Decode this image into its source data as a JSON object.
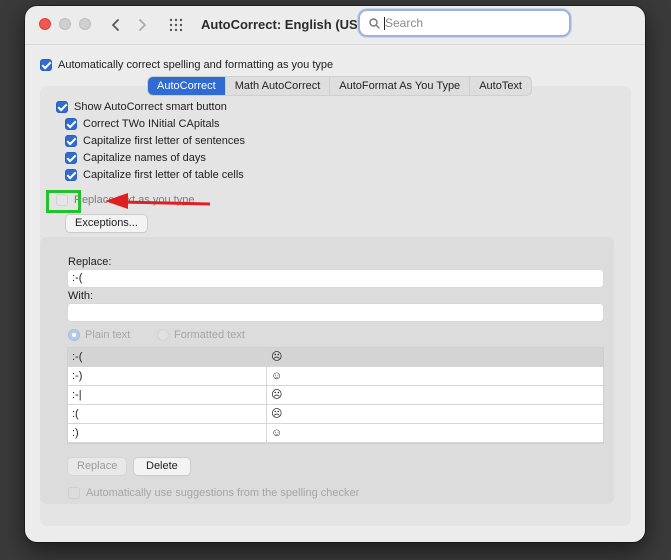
{
  "window": {
    "title": "AutoCorrect: English (US)",
    "search_placeholder": "Search"
  },
  "top_option": {
    "label": "Automatically correct spelling and formatting as you type",
    "checked": true
  },
  "tabs": [
    {
      "label": "AutoCorrect",
      "active": true
    },
    {
      "label": "Math AutoCorrect",
      "active": false
    },
    {
      "label": "AutoFormat As You Type",
      "active": false
    },
    {
      "label": "AutoText",
      "active": false
    }
  ],
  "options": [
    {
      "label": "Show AutoCorrect smart button",
      "checked": true
    },
    {
      "label": "Correct TWo INitial CApitals",
      "checked": true
    },
    {
      "label": "Capitalize first letter of sentences",
      "checked": true
    },
    {
      "label": "Capitalize names of days",
      "checked": true
    },
    {
      "label": "Capitalize first letter of table cells",
      "checked": true
    },
    {
      "label": "Replace text as you type",
      "checked": false
    }
  ],
  "exceptions_button": "Exceptions...",
  "replace_label": "Replace:",
  "replace_value": ":-(",
  "with_label": "With:",
  "with_value": "",
  "radio": {
    "plain": "Plain text",
    "formatted": "Formatted text"
  },
  "table": {
    "rows": [
      {
        "from": ":-(",
        "to": "☹"
      },
      {
        "from": ":-)",
        "to": "☺"
      },
      {
        "from": ":-|",
        "to": "☹"
      },
      {
        "from": ":(",
        "to": "☹"
      },
      {
        "from": ":)",
        "to": "☺"
      }
    ]
  },
  "buttons": {
    "replace": "Replace",
    "delete": "Delete"
  },
  "bottom_option": {
    "label": "Automatically use suggestions from the spelling checker",
    "checked": false
  },
  "colors": {
    "accent": "#2f6bd0",
    "highlight": "#22c32a",
    "arrow": "#e02020"
  }
}
